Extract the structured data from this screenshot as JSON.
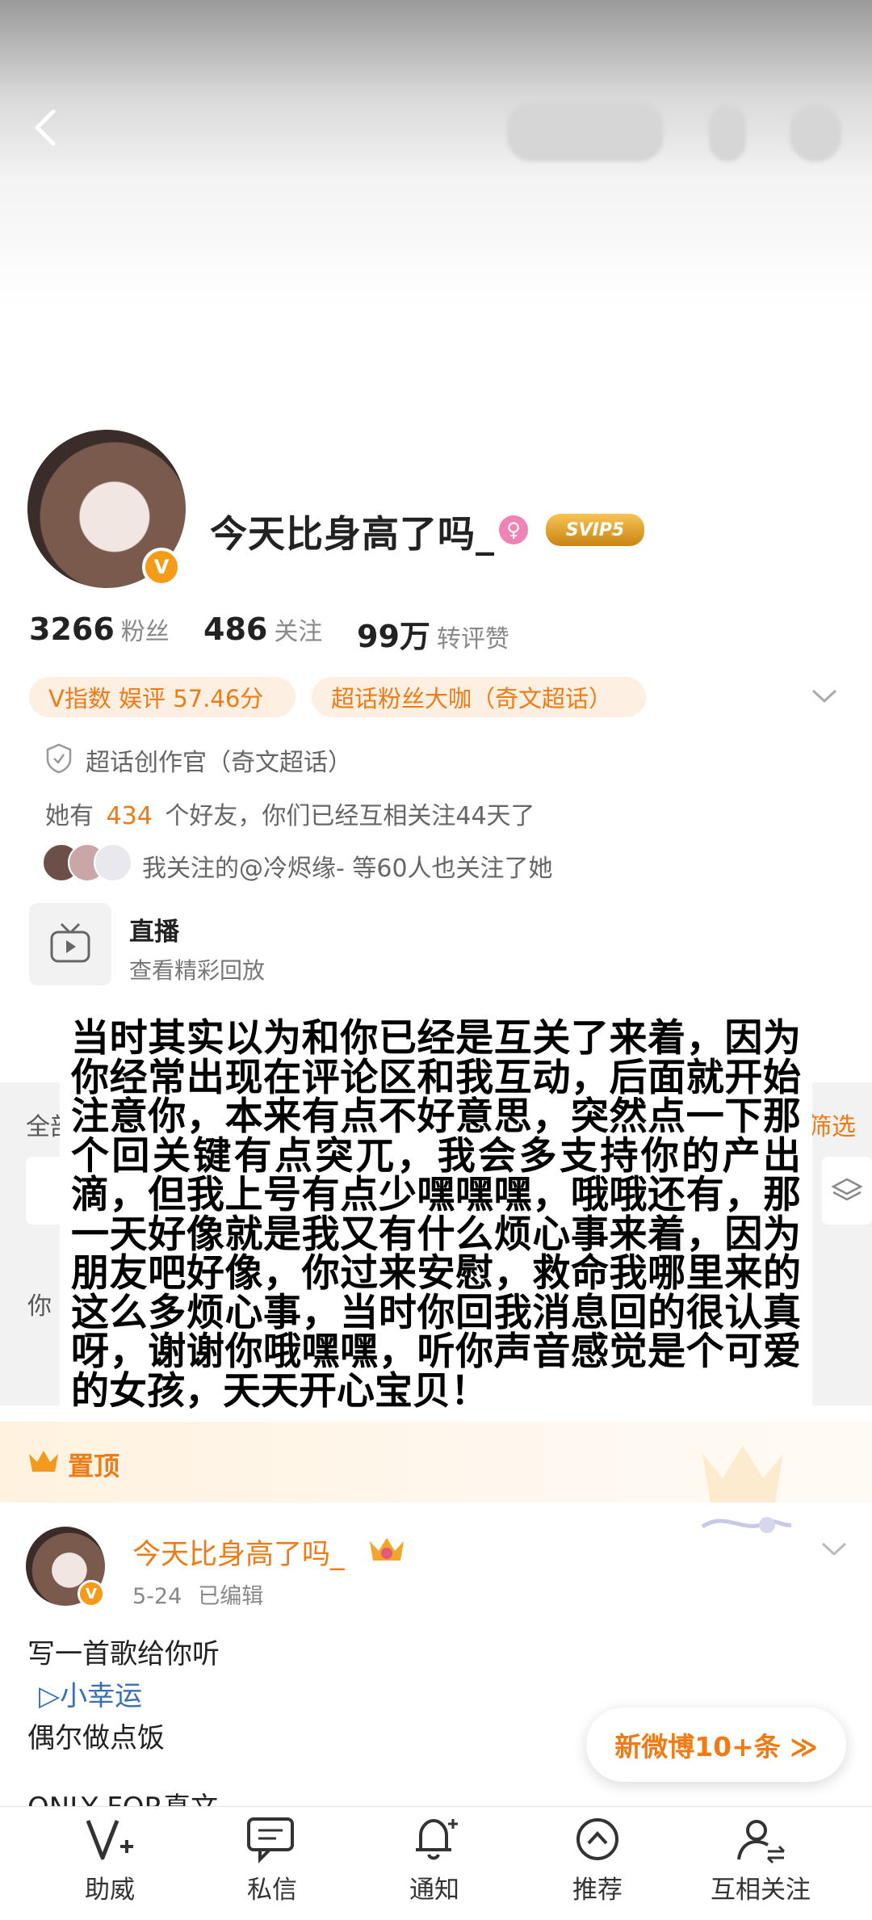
{
  "profile": {
    "username": "今天比身高了吗_",
    "gender_icon": "female-icon",
    "svip_label": "SVIP5",
    "verified_icon": "v-verified-icon"
  },
  "stats": [
    {
      "value": "3266",
      "label": "粉丝"
    },
    {
      "value": "486",
      "label": "关注"
    },
    {
      "value": "99万",
      "label": "转评赞"
    }
  ],
  "tags": {
    "v_index": "V指数 娱评 57.46分",
    "super_fan": "超话粉丝大咖（奇文超话）"
  },
  "creator_line": "超话创作官（奇文超话）",
  "friends_line": {
    "prefix": "她有",
    "count": "434",
    "suffix": "个好友，你们已经互相关注44天了"
  },
  "mutual_line": "我关注的@冷烬缘- 等60人也关注了她",
  "live": {
    "title": "直播",
    "subtitle": "查看精彩回放"
  },
  "popup_text": "当时其实以为和你已经是互关了来着，因为你经常出现在评论区和我互动，后面就开始注意你，本来有点不好意思，突然点一下那个回关键有点突兀，我会多支持你的产出滴，但我上号有点少嘿嘿嘿，哦哦还有，那一天好像就是我又有什么烦心事来着，因为朋友吧好像，你过来安慰，救命我哪里来的这么多烦心事，当时你回我消息回的很认真呀，谢谢你哦嘿嘿，听你声音感觉是个可爱的女孩，天天开心宝贝！",
  "behind_fragments": {
    "all": "全部",
    "filter": "筛选",
    "you": "你"
  },
  "pinned": {
    "label": "置顶"
  },
  "post": {
    "author": "今天比身高了吗_",
    "date": "5-24",
    "edited": "已编辑",
    "lines": [
      "写一首歌给你听",
      "▷小幸运",
      "偶尔做点饭"
    ],
    "partial_line": "ONLY FOR真文"
  },
  "new_posts_button": "新微博10+条 ≫",
  "tabbar": [
    {
      "label": "助威",
      "icon": "cheer-v-icon"
    },
    {
      "label": "私信",
      "icon": "message-icon"
    },
    {
      "label": "通知",
      "icon": "bell-icon"
    },
    {
      "label": "推荐",
      "icon": "recommend-icon"
    },
    {
      "label": "互相关注",
      "icon": "mutual-follow-icon"
    }
  ],
  "colors": {
    "accent": "#f07a14",
    "tag_bg": "#fdf0e2"
  }
}
